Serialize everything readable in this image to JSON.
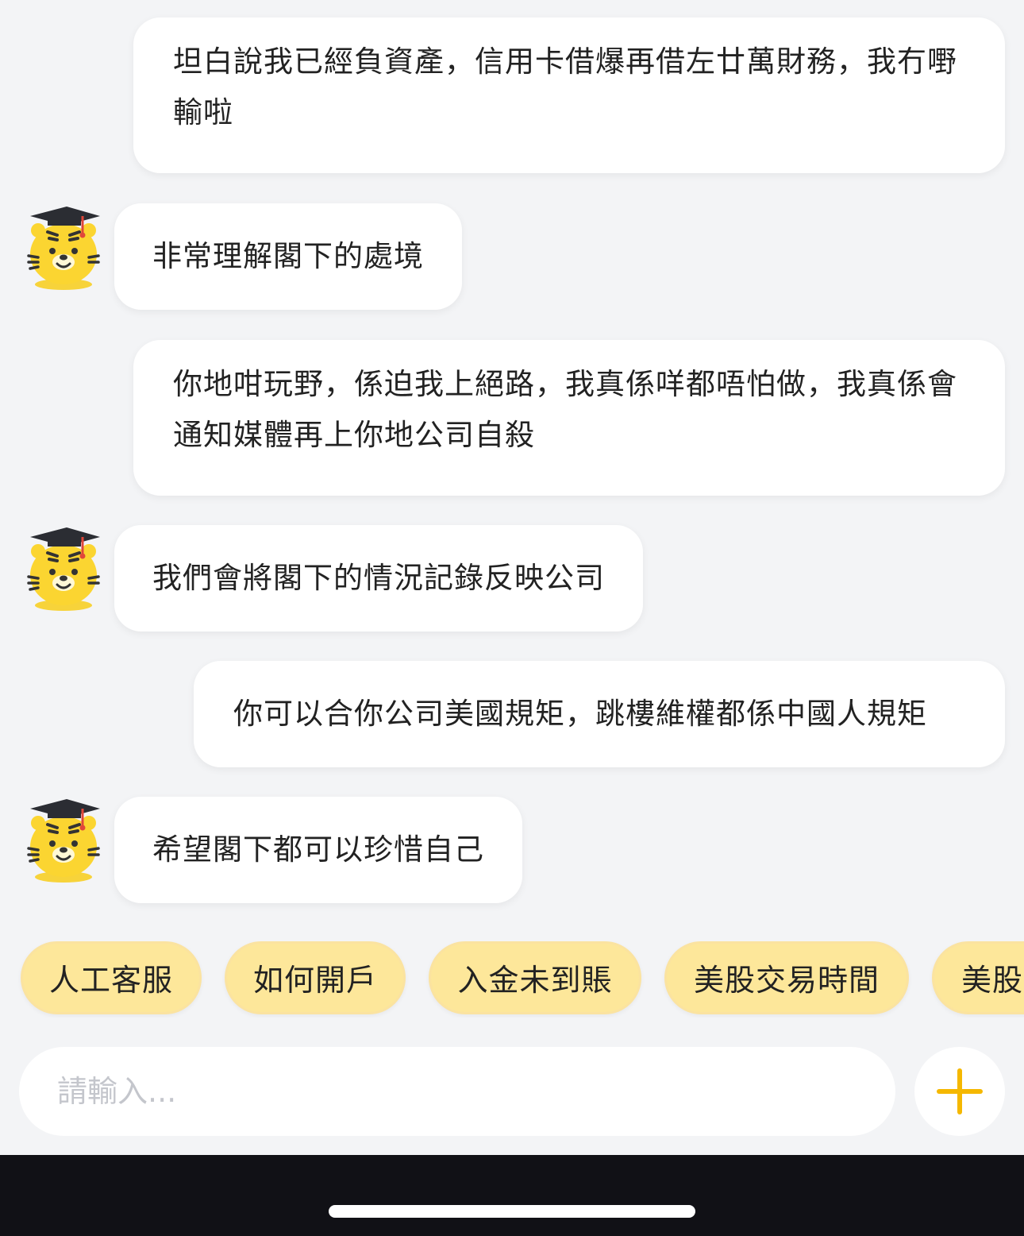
{
  "messages": [
    {
      "role": "user",
      "text": "坦白說我已經負資產，信用卡借爆再借左廿萬財務，我冇嘢輸啦"
    },
    {
      "role": "bot",
      "text": "非常理解閣下的處境"
    },
    {
      "role": "user",
      "text": "你地咁玩野，係迫我上絕路，我真係咩都唔怕做，我真係會通知媒體再上你地公司自殺"
    },
    {
      "role": "bot",
      "text": "我們會將閣下的情況記錄反映公司"
    },
    {
      "role": "user",
      "text": "你可以合你公司美國規矩，跳樓維權都係中國人規矩"
    },
    {
      "role": "bot",
      "text": "希望閣下都可以珍惜自己"
    }
  ],
  "bot_avatar_icon": "tiger-graduate-icon",
  "quick_replies": [
    "人工客服",
    "如何開戶",
    "入金未到賬",
    "美股交易時間",
    "美股"
  ],
  "input": {
    "placeholder": "請輸入..."
  },
  "plus_icon": "plus-icon",
  "colors": {
    "chip_bg": "#fde79a",
    "accent": "#f5b800",
    "bubble": "#ffffff",
    "background": "#f3f4f6"
  }
}
